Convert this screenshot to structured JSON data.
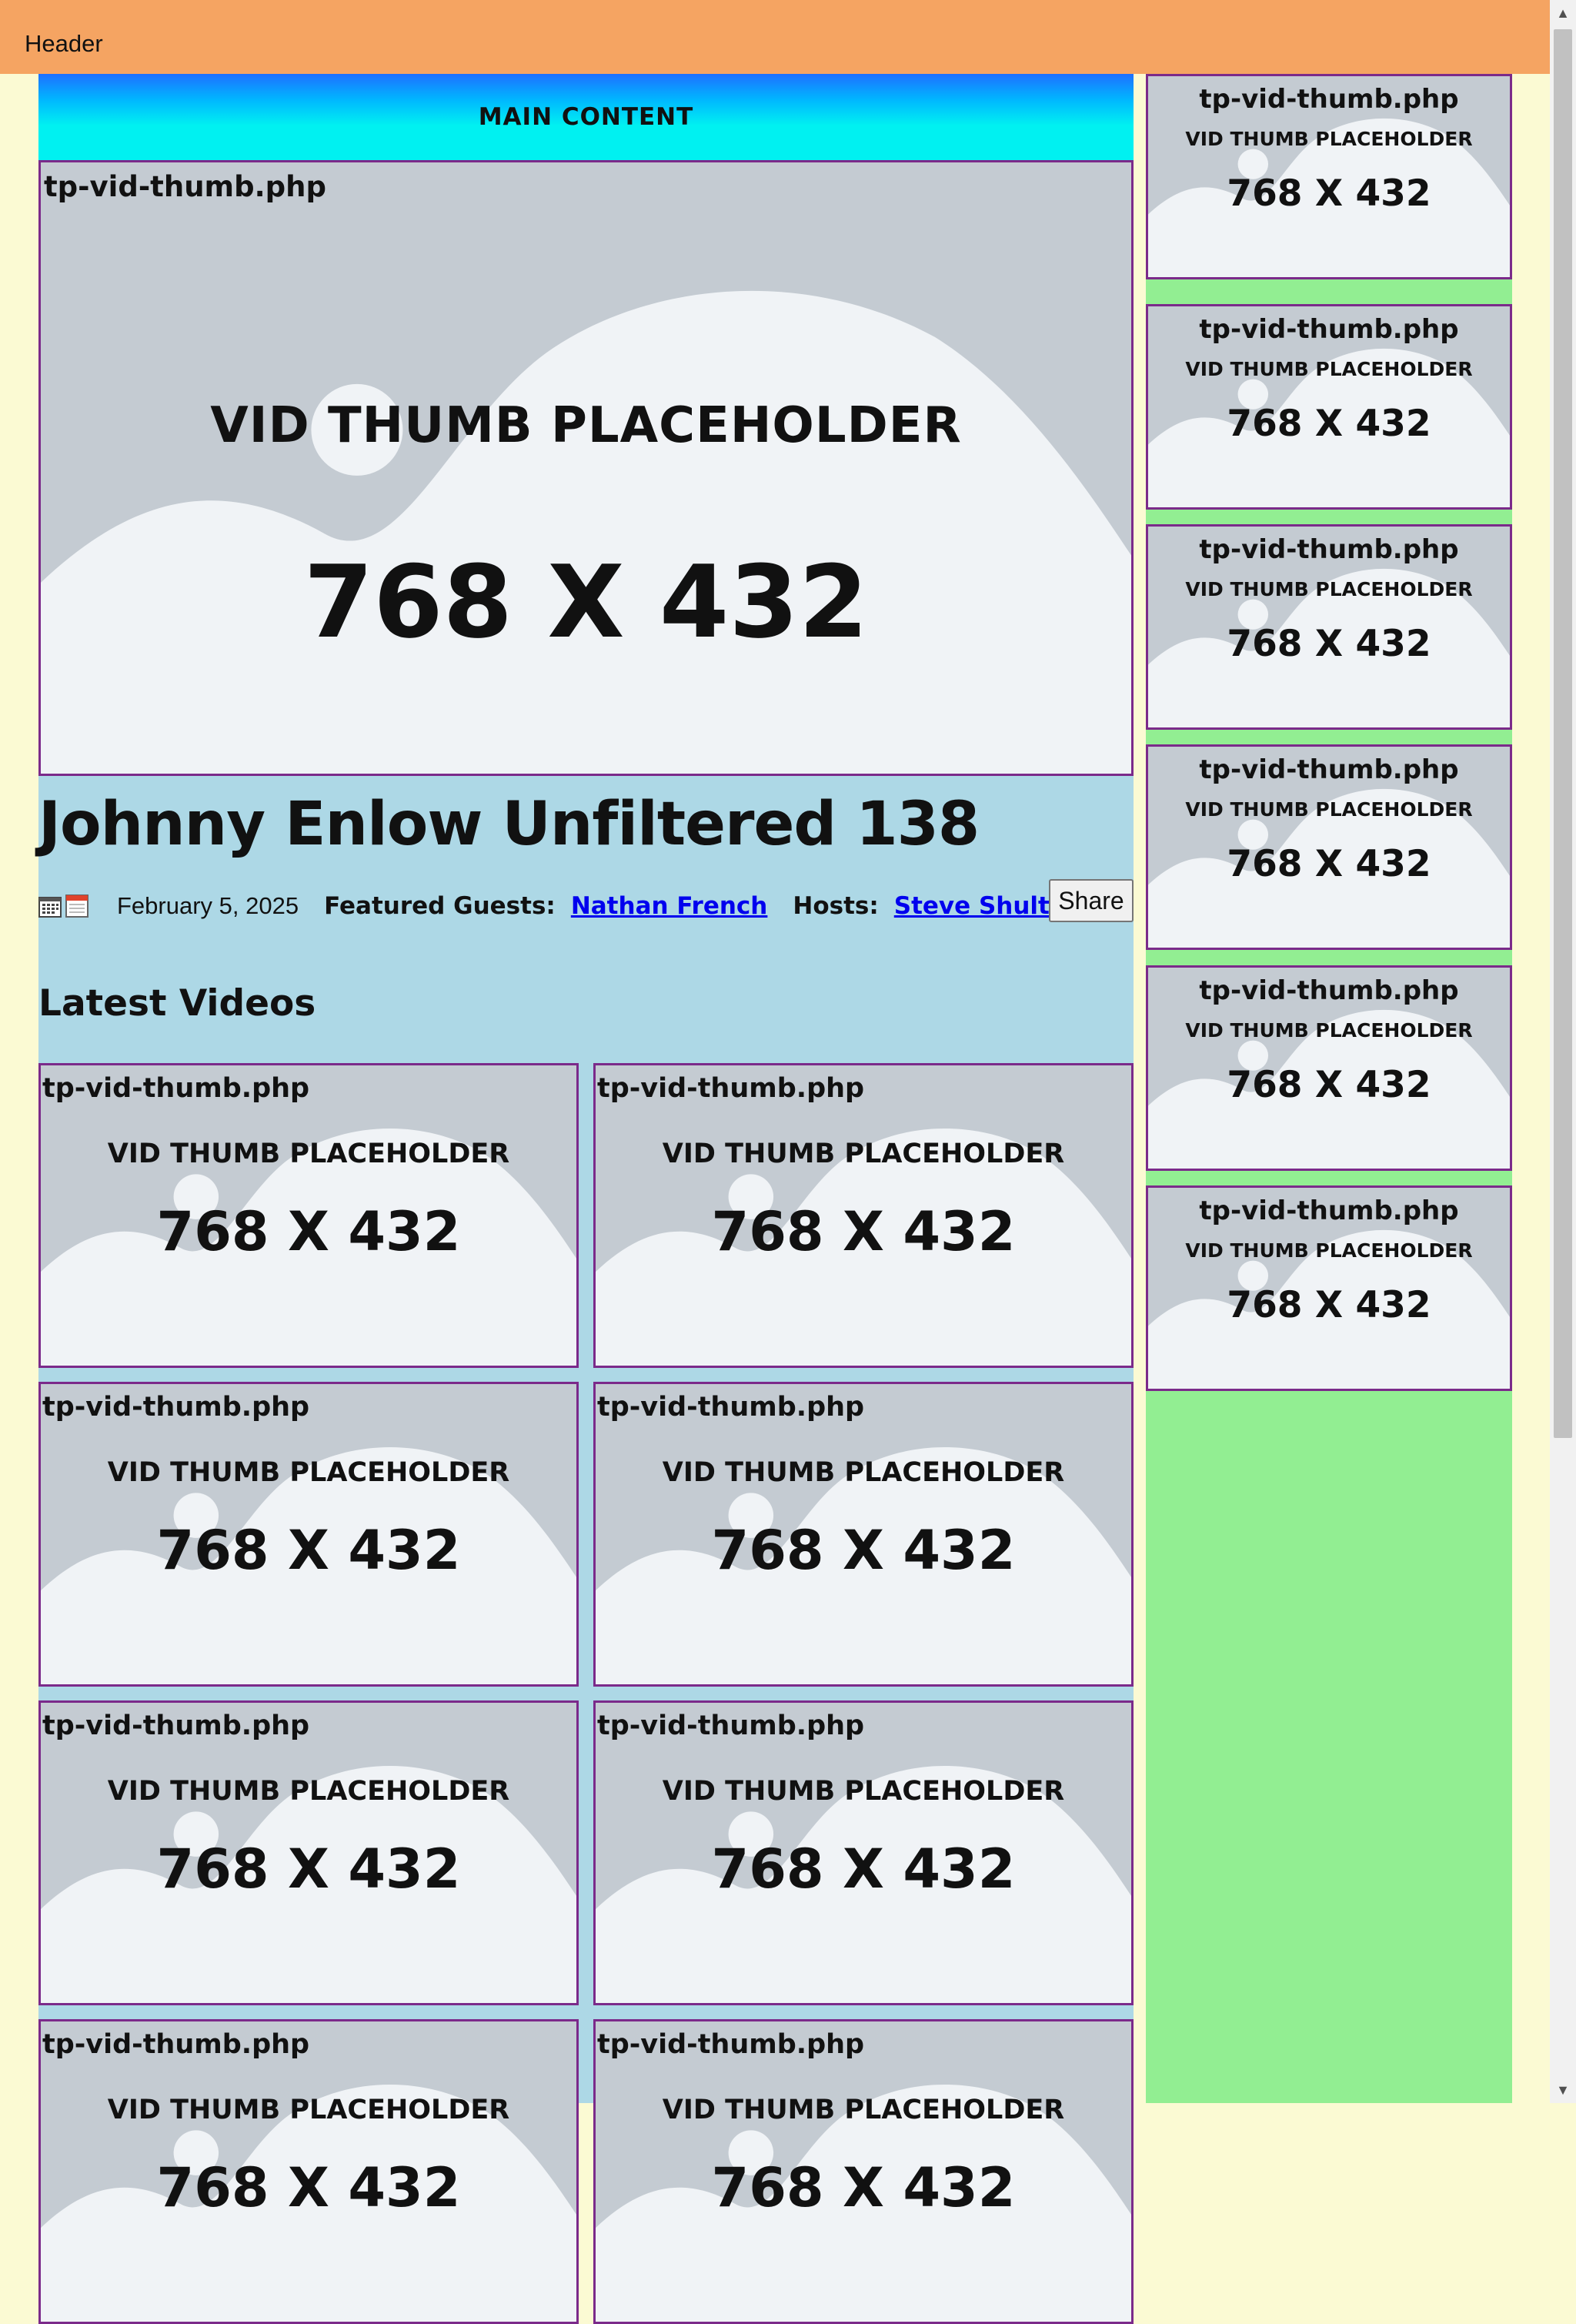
{
  "header": {
    "title": "Header"
  },
  "main": {
    "banner": "MAIN CONTENT",
    "hero_thumb": {
      "file": "tp-vid-thumb.php",
      "placeholder": "VID THUMB PLACEHOLDER",
      "dims": "768 X 432"
    },
    "title": "Johnny Enlow Unfiltered 138",
    "meta": {
      "date": "February 5, 2025",
      "guests_label": "Featured Guests:",
      "guest": "Nathan French",
      "hosts_label": "Hosts:",
      "host": "Steve Shultz"
    },
    "share_label": "Share",
    "latest_title": "Latest Videos",
    "latest": [
      {
        "file": "tp-vid-thumb.php",
        "placeholder": "VID THUMB PLACEHOLDER",
        "dims": "768 X 432"
      },
      {
        "file": "tp-vid-thumb.php",
        "placeholder": "VID THUMB PLACEHOLDER",
        "dims": "768 X 432"
      },
      {
        "file": "tp-vid-thumb.php",
        "placeholder": "VID THUMB PLACEHOLDER",
        "dims": "768 X 432"
      },
      {
        "file": "tp-vid-thumb.php",
        "placeholder": "VID THUMB PLACEHOLDER",
        "dims": "768 X 432"
      },
      {
        "file": "tp-vid-thumb.php",
        "placeholder": "VID THUMB PLACEHOLDER",
        "dims": "768 X 432"
      },
      {
        "file": "tp-vid-thumb.php",
        "placeholder": "VID THUMB PLACEHOLDER",
        "dims": "768 X 432"
      },
      {
        "file": "tp-vid-thumb.php",
        "placeholder": "VID THUMB PLACEHOLDER",
        "dims": "768 X 432"
      },
      {
        "file": "tp-vid-thumb.php",
        "placeholder": "VID THUMB PLACEHOLDER",
        "dims": "768 X 432"
      }
    ]
  },
  "sidebar": {
    "thumbs": [
      {
        "file": "tp-vid-thumb.php",
        "placeholder": "VID THUMB PLACEHOLDER",
        "dims": "768 X 432"
      },
      {
        "file": "tp-vid-thumb.php",
        "placeholder": "VID THUMB PLACEHOLDER",
        "dims": "768 X 432"
      },
      {
        "file": "tp-vid-thumb.php",
        "placeholder": "VID THUMB PLACEHOLDER",
        "dims": "768 X 432"
      },
      {
        "file": "tp-vid-thumb.php",
        "placeholder": "VID THUMB PLACEHOLDER",
        "dims": "768 X 432"
      },
      {
        "file": "tp-vid-thumb.php",
        "placeholder": "VID THUMB PLACEHOLDER",
        "dims": "768 X 432"
      },
      {
        "file": "tp-vid-thumb.php",
        "placeholder": "VID THUMB PLACEHOLDER",
        "dims": "768 X 432"
      }
    ]
  },
  "icons": {
    "calendar": "calendar-icon",
    "scroll_up": "scroll-up-arrow-icon",
    "scroll_down": "scroll-down-arrow-icon"
  },
  "colors": {
    "header_bg": "#f5a462",
    "page_bg": "#fbfad3",
    "main_bg": "#add8e6",
    "sidebar_bg": "#92ee92",
    "thumb_border": "#7b2a8a",
    "link": "#0000ee"
  }
}
